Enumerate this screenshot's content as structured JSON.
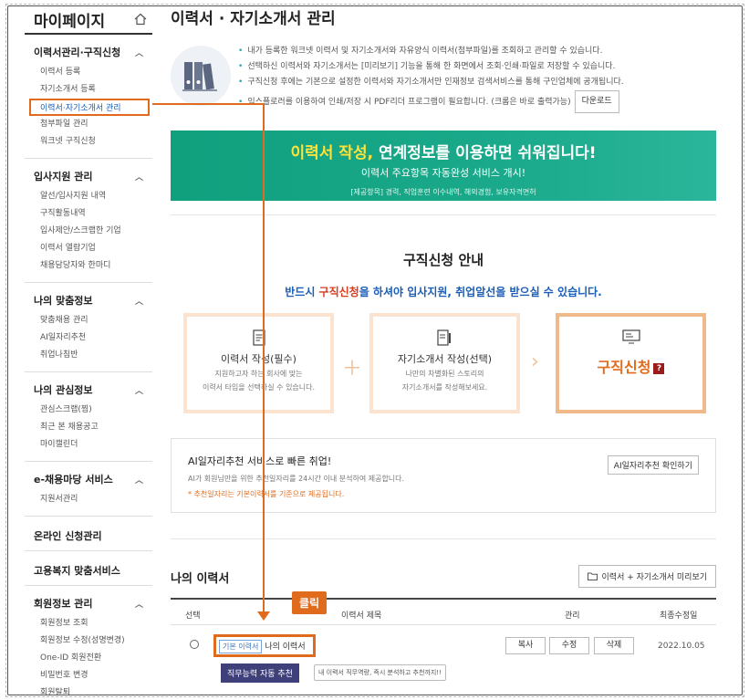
{
  "sidebar": {
    "title": "마이페이지",
    "groups": [
      {
        "label": "이력서관리·구직신청",
        "items": [
          "이력서 등록",
          "자기소개서 등록",
          "이력서·자기소개서 관리",
          "첨부파일 관리",
          "워크넷 구직신청"
        ]
      },
      {
        "label": "입사지원 관리",
        "items": [
          "알선/입사지원 내역",
          "구직활동내역",
          "입사제안/스크랩한 기업",
          "이력서 열람기업",
          "채용담당자와 한마디"
        ]
      },
      {
        "label": "나의 맞춤정보",
        "items": [
          "맞춤채용 관리",
          "AI일자리추천",
          "취업나침반"
        ]
      },
      {
        "label": "나의 관심정보",
        "items": [
          "관심스크랩(찜)",
          "최근 본 채용공고",
          "마이캘린더"
        ]
      },
      {
        "label": "e-채용마당 서비스",
        "items": [
          "지원서관리"
        ]
      }
    ],
    "solo": [
      "온라인 신청관리",
      "고용복지 맞춤서비스"
    ],
    "member": {
      "label": "회원정보 관리",
      "items": [
        "회원정보 조회",
        "회원정보 수정(성명변경)",
        "One-ID 회원전환",
        "비밀번호 변경",
        "회원탈퇴"
      ]
    }
  },
  "main": {
    "title": "이력서 · 자기소개서 관리",
    "intro": [
      "내가 등록한 워크넷 이력서 및 자기소개서와 자유양식 이력서(첨부파일)를 조회하고 관리할 수 있습니다.",
      "선택하신 이력서와 자기소개서는 [미리보기] 기능을 통해 한 화면에서 조회·인쇄·파일로 저장할 수 있습니다.",
      "구직신청 후에는 기본으로 설정한 이력서와 자기소개서만 인재정보 검색서비스를 통해 구인업체에 공개됩니다.",
      "익스플로러를 이용하여 인쇄/저장 시 PDF리더 프로그램이 필요합니다. (크롬은 바로 출력가능)"
    ],
    "download_label": "다운로드",
    "banner": {
      "line1_hl": "이력서 작성,",
      "line1_bold": " 연계정보",
      "line1_rest": "를 이용하면 쉬워집니다!",
      "line2": "이력서 주요항목 자동완성 서비스 개시!",
      "line3": "[제공항목] 경력, 직업훈련 이수내역, 해외경험, 보유자격면허"
    },
    "guide": {
      "title": "구직신청 안내",
      "sub_pre": "반드시 ",
      "sub_red": "구직신청",
      "sub_post": "을 하셔야 입사지원, 취업알선을 받으실 수 있습니다.",
      "steps": [
        {
          "title": "이력서 작성(필수)",
          "desc1": "지원하고자 하는 회사에 맞는",
          "desc2": "이력서 타입을 선택하실 수 있습니다."
        },
        {
          "title": "자기소개서 작성(선택)",
          "desc1": "나만의 차별화된 스토리의",
          "desc2": "자기소개서를 작성해보세요."
        },
        {
          "title": "구직신청",
          "badge": "?"
        }
      ]
    },
    "ai": {
      "title": "AI일자리추천 서비스로 빠른 취업!",
      "desc": "AI가 회원님만을 위한 추천일자리를 24시간 이내 분석하여 제공합니다.",
      "note": "* 추천일자리는 기본이력서를 기준으로 제공됩니다.",
      "button": "AI일자리추천 확인하기"
    },
    "resume": {
      "title": "나의 이력서",
      "preview_button": "이력서 + 자기소개서 미리보기",
      "columns": [
        "선택",
        "이력서 제목",
        "관리",
        "최종수정일"
      ],
      "row": {
        "tag": "기본 이력서",
        "name": "나의 이력서",
        "actions": [
          "복사",
          "수정",
          "삭제"
        ],
        "date": "2022.10.05",
        "auto_button": "직무능력 자동 추천",
        "tip": "내 이력서 직무역량, 즉시 분석하고 추천까지!!"
      }
    }
  },
  "annotation": {
    "click_label": "클릭"
  },
  "colors": {
    "accent": "#e06b1c",
    "banner": "#10a07e",
    "link": "#1a5db8"
  }
}
